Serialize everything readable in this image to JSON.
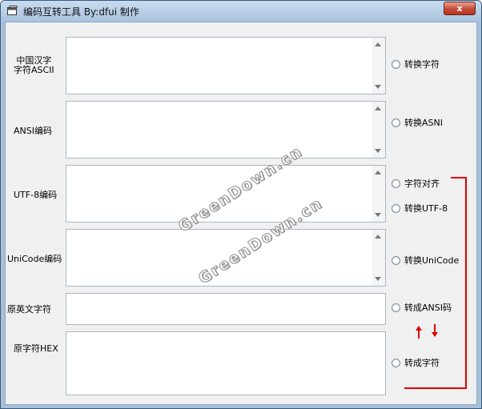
{
  "window": {
    "title": "编码互转工具  By:dfui 制作",
    "close_label": "x"
  },
  "rows": {
    "row1_label_line1": "中国汉字",
    "row1_label_line2": "字符ASCII",
    "row2_label": "ANSI编码",
    "row3_label": "UTF-8编码",
    "row4_label": "UniCode编码",
    "row5_label": "原英文字符",
    "row6_label": "原字符HEX"
  },
  "options": {
    "convert_chars": "转换字符",
    "convert_ansi": "转换ASNI",
    "char_align": "字符对齐",
    "convert_utf8": "转换UTF-8",
    "convert_unicode": "转换UniCode",
    "to_ansi": "转成ANSI码",
    "to_chars": "转成字符"
  },
  "watermark": {
    "text_1": "GreenDown.cn",
    "text_2": "GreenDown.cn"
  },
  "colors": {
    "annotation_red": "#e00000"
  }
}
